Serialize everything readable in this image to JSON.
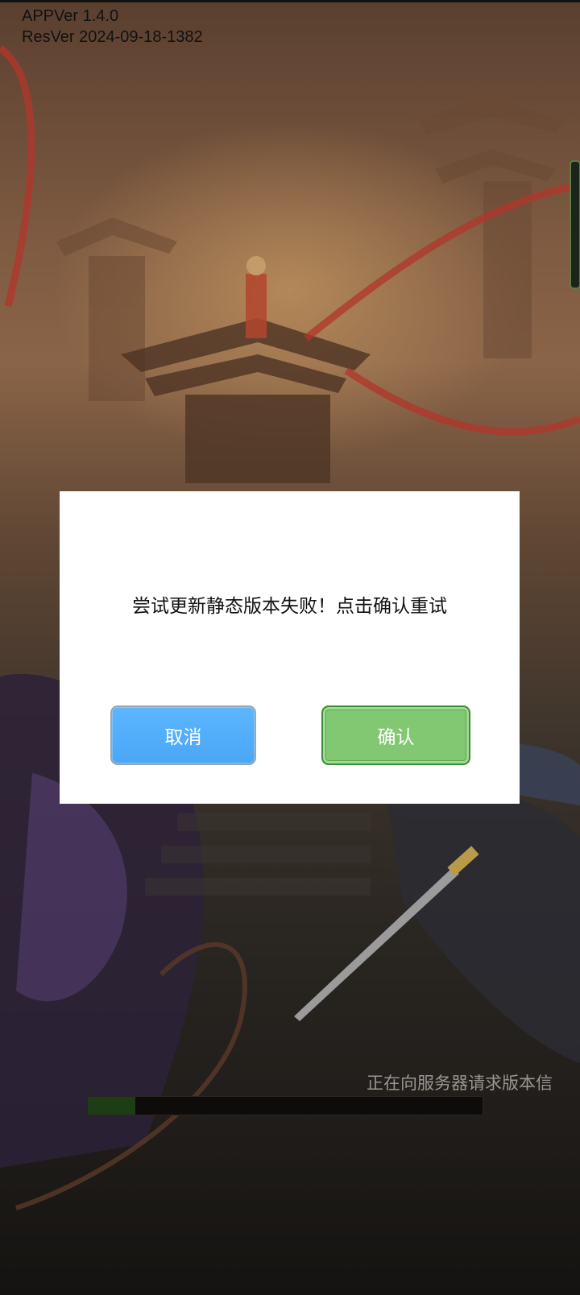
{
  "version": {
    "app": "APPVer 1.4.0",
    "res": "ResVer 2024-09-18-1382"
  },
  "dialog": {
    "message": "尝试更新静态版本失败！点击确认重试",
    "cancel_label": "取消",
    "confirm_label": "确认"
  },
  "loading": {
    "status_text": "正在向服务器请求版本信",
    "progress": 0.12
  },
  "colors": {
    "cancel_button": "#4aa7f5",
    "confirm_button": "#82c872",
    "progress_fill": "#1e3d17"
  }
}
